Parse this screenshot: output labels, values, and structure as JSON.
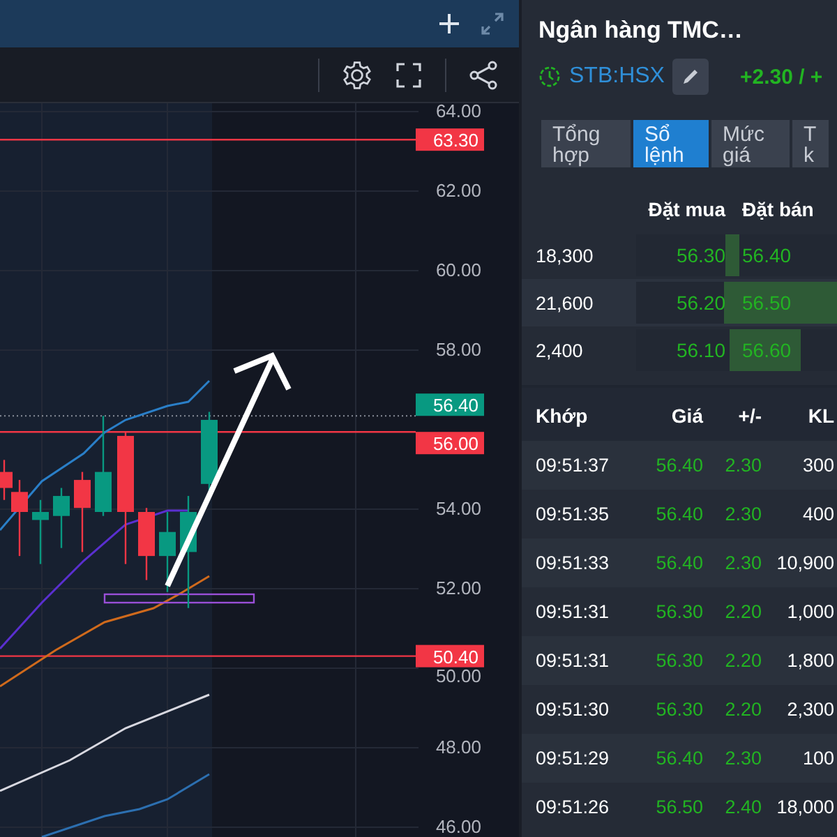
{
  "price_axis": {
    "ticks": [
      "64.00",
      "62.00",
      "60.00",
      "58.00",
      "54.00",
      "52.00",
      "50.00",
      "48.00",
      "46.00"
    ]
  },
  "price_tags": [
    {
      "value": "63.30",
      "color": "#f23645"
    },
    {
      "value": "56.40",
      "color": "#089981"
    },
    {
      "value": "56.00",
      "color": "#f23645"
    },
    {
      "value": "50.40",
      "color": "#f23645"
    }
  ],
  "stock": {
    "name": "Ngân hàng TMC…",
    "symbol": "STB:HSX",
    "change": "+2.30 / +"
  },
  "tabs": [
    {
      "label": "Tổng hợp",
      "selected": false
    },
    {
      "label": "Sổ lệnh",
      "selected": true
    },
    {
      "label": "Mức giá",
      "selected": false
    },
    {
      "label": "T k",
      "selected": false
    }
  ],
  "order_book": {
    "columns": [
      "Đặt mua",
      "Đặt bán"
    ],
    "rows": [
      {
        "volume": "18,300",
        "bid": {
          "price": "56.30",
          "level": 0.08
        },
        "ask": {
          "price": "56.40",
          "level": 0.05
        }
      },
      {
        "volume": "21,600",
        "bid": {
          "price": "56.20",
          "level": 0.1
        },
        "ask": {
          "price": "56.50",
          "level": 1
        }
      },
      {
        "volume": "2,400",
        "bid": {
          "price": "56.10",
          "level": 0.05
        },
        "ask": {
          "price": "56.60",
          "level": 0.6
        }
      }
    ]
  },
  "trades": {
    "columns": [
      "Khớp",
      "Giá",
      "+/-",
      "KL"
    ],
    "rows": [
      {
        "time": "09:51:37",
        "price": "56.40",
        "change": "2.30",
        "volume": "300"
      },
      {
        "time": "09:51:35",
        "price": "56.40",
        "change": "2.30",
        "volume": "400"
      },
      {
        "time": "09:51:33",
        "price": "56.40",
        "change": "2.30",
        "volume": "10,900"
      },
      {
        "time": "09:51:31",
        "price": "56.30",
        "change": "2.20",
        "volume": "1,000"
      },
      {
        "time": "09:51:31",
        "price": "56.30",
        "change": "2.20",
        "volume": "1,800"
      },
      {
        "time": "09:51:30",
        "price": "56.30",
        "change": "2.20",
        "volume": "2,300"
      },
      {
        "time": "09:51:29",
        "price": "56.40",
        "change": "2.30",
        "volume": "100"
      },
      {
        "time": "09:51:26",
        "price": "56.50",
        "change": "2.40",
        "volume": "18,000"
      }
    ]
  }
}
